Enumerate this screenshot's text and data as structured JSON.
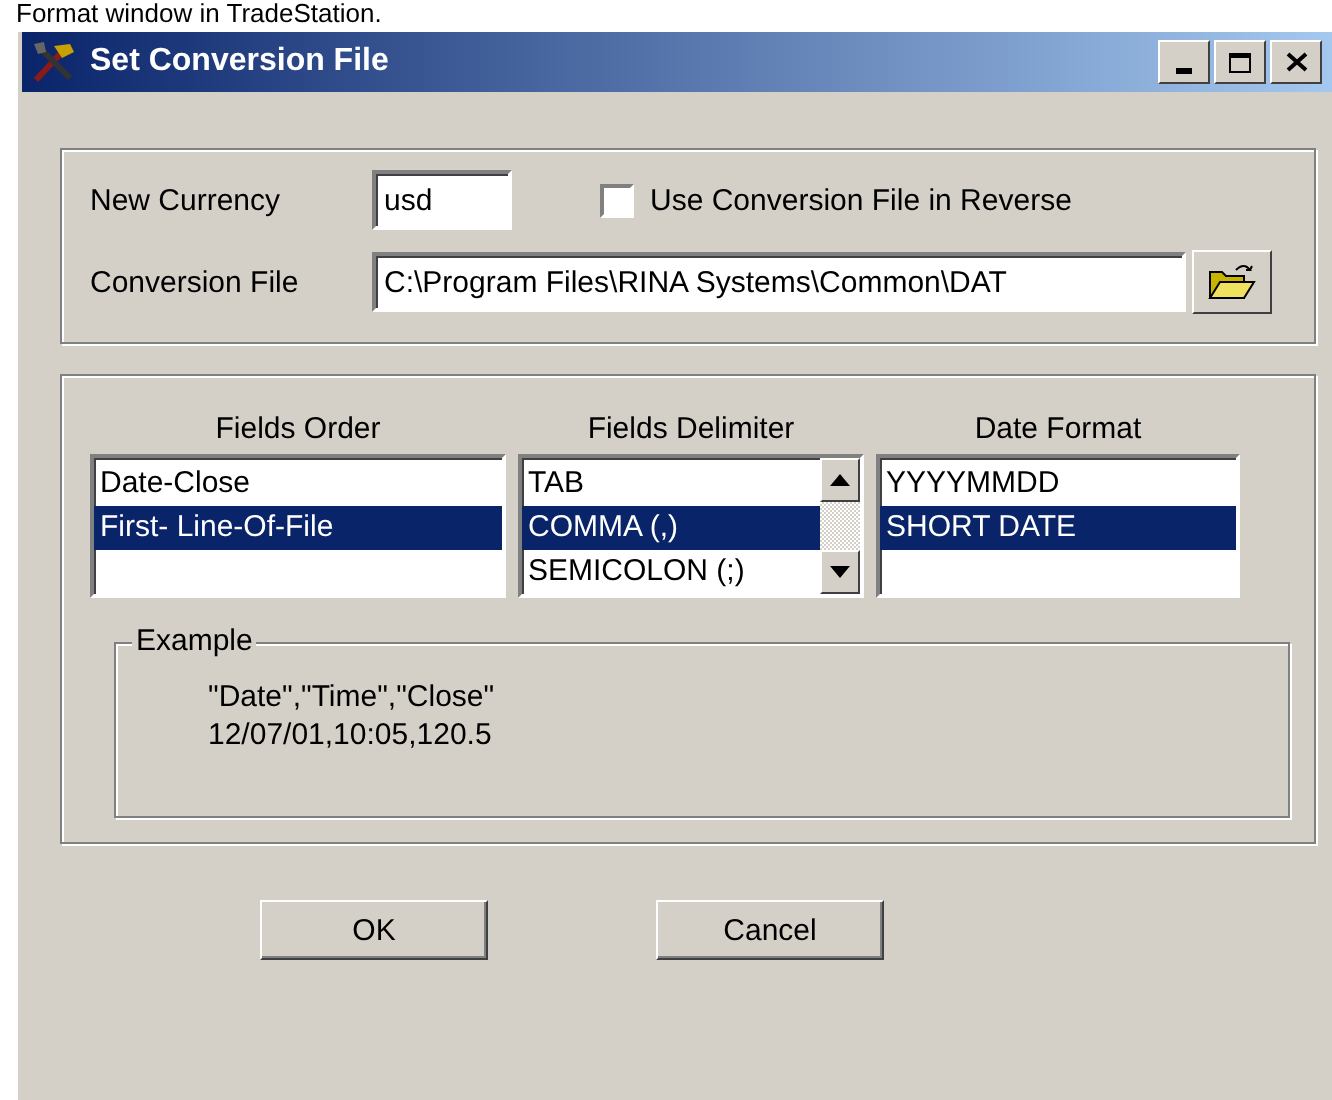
{
  "page_caption": {
    "text": "Format window in TradeStation."
  },
  "window": {
    "title": "Set Conversion File"
  },
  "currency": {
    "label": "New Currency",
    "value": "usd"
  },
  "reverse": {
    "label": "Use Conversion File in Reverse",
    "checked": false
  },
  "file": {
    "label": "Conversion File",
    "value": "C:\\Program Files\\RINA Systems\\Common\\DAT"
  },
  "lists": [
    {
      "heading": "Fields Order",
      "scrollable": false,
      "items": [
        {
          "text": "Date-Close",
          "selected": false
        },
        {
          "text": "First- Line-Of-File",
          "selected": true
        }
      ]
    },
    {
      "heading": "Fields Delimiter",
      "scrollable": true,
      "items": [
        {
          "text": "TAB",
          "selected": false
        },
        {
          "text": "COMMA (,)",
          "selected": true
        },
        {
          "text": "SEMICOLON (;)",
          "selected": false
        }
      ]
    },
    {
      "heading": "Date Format",
      "scrollable": false,
      "items": [
        {
          "text": "YYYYMMDD",
          "selected": false
        },
        {
          "text": "SHORT DATE",
          "selected": true
        }
      ]
    }
  ],
  "example": {
    "legend": "Example",
    "lines": [
      "\"Date\",\"Time\",\"Close\"",
      "12/07/01,10:05,120.5"
    ]
  },
  "buttons": [
    {
      "label": "OK"
    },
    {
      "label": "Cancel"
    }
  ]
}
